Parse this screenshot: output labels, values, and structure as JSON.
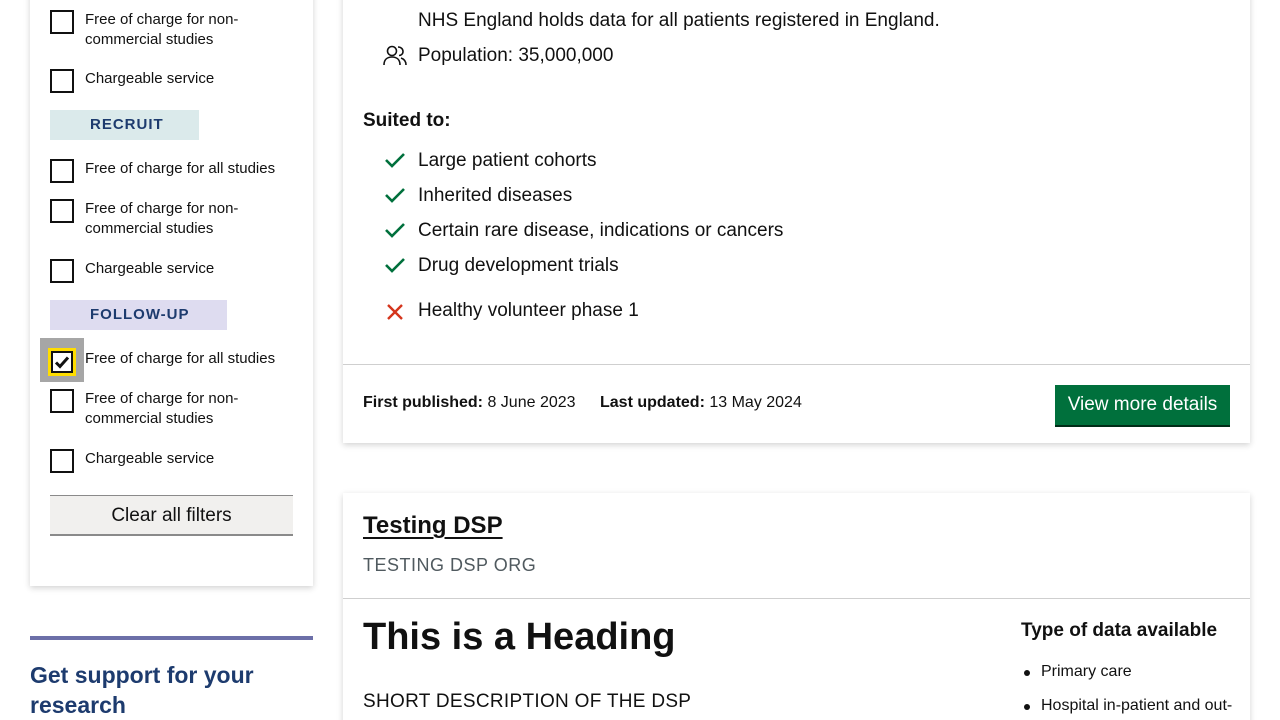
{
  "sidebar": {
    "top_options": [
      {
        "label": "Free of charge for non-commercial studies",
        "checked": false
      },
      {
        "label": "Chargeable service",
        "checked": false
      }
    ],
    "recruit": {
      "tag": "RECRUIT",
      "tag_color": "#dbeaeb",
      "options": [
        {
          "label": "Free of charge for all studies",
          "checked": false
        },
        {
          "label": "Free of charge for non-commercial studies",
          "checked": false
        },
        {
          "label": "Chargeable service",
          "checked": false
        }
      ]
    },
    "follow_up": {
      "tag": "FOLLOW-UP",
      "tag_color": "#dedcf0",
      "options": [
        {
          "label": "Free of charge for all studies",
          "checked": true
        },
        {
          "label": "Free of charge for non-commercial studies",
          "checked": false
        },
        {
          "label": "Chargeable service",
          "checked": false
        }
      ]
    },
    "clear_button": "Clear all filters",
    "support_title": "Get support for your research"
  },
  "card1": {
    "coverage_text": "NHS England holds data for all patients registered in England.",
    "population": "Population: 35,000,000",
    "suited_title": "Suited to:",
    "suited_items": [
      "Large patient cohorts",
      "Inherited diseases",
      "Certain rare disease, indications or cancers",
      "Drug development trials"
    ],
    "not_suited_items": [
      "Healthy volunteer phase 1"
    ],
    "first_published_label": "First published:",
    "first_published_value": "8 June 2023",
    "last_updated_label": "Last updated:",
    "last_updated_value": "13 May 2024",
    "view_button": "View more details"
  },
  "card2": {
    "title": "Testing DSP",
    "org": "TESTING DSP ORG",
    "heading": "This is a Heading",
    "short_description": "SHORT DESCRIPTION OF THE DSP",
    "type_title": "Type of data available",
    "types": [
      "Primary care",
      "Hospital in-patient and out-"
    ]
  },
  "colors": {
    "accent_green": "#00703c",
    "error_red": "#d4351c",
    "navy": "#1d3b6e",
    "focus_yellow": "#ffdd00"
  }
}
